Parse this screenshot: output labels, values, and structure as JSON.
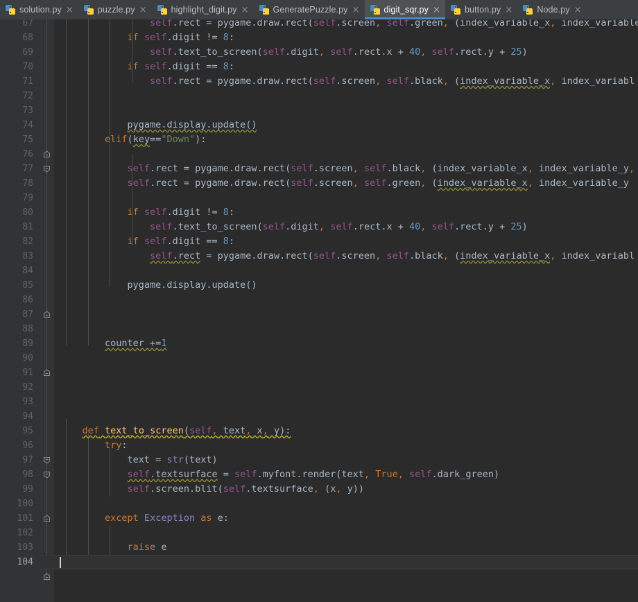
{
  "window": {
    "active_file": "digit_sqr.py",
    "accent_color": "#4a88c7",
    "editor_bg": "#2b2b2b",
    "gutter_bg": "#313335",
    "tabbar_bg": "#3c3f41"
  },
  "tabs": [
    {
      "label": "solution.py",
      "icon": "python-file-icon",
      "close_icon": "×",
      "active": false
    },
    {
      "label": "puzzle.py",
      "icon": "python-file-icon",
      "close_icon": "×",
      "active": false
    },
    {
      "label": "highlight_digit.py",
      "icon": "python-file-icon",
      "close_icon": "×",
      "active": false
    },
    {
      "label": "GeneratePuzzle.py",
      "icon": "python-file-icon",
      "close_icon": "×",
      "active": false
    },
    {
      "label": "digit_sqr.py",
      "icon": "python-file-icon",
      "close_icon": "×",
      "active": true
    },
    {
      "label": "button.py",
      "icon": "python-file-icon",
      "close_icon": "×",
      "active": false
    },
    {
      "label": "Node.py",
      "icon": "python-file-icon",
      "close_icon": "×",
      "active": false
    }
  ],
  "editor": {
    "current_line": 104,
    "first_visible_line": 67,
    "last_visible_line": 104,
    "caret_column": 1,
    "lines": [
      {
        "n": 67,
        "clipped_top": true,
        "text": "                self.rect = pygame.draw.rect(self.screen, self.green, (index_variable_x, index_variable_y"
      },
      {
        "n": 68,
        "text": "            if self.digit != 8:"
      },
      {
        "n": 69,
        "text": "                self.text_to_screen(self.digit, self.rect.x + 40, self.rect.y + 25)"
      },
      {
        "n": 70,
        "text": "            if self.digit == 8:"
      },
      {
        "n": 71,
        "text": "                self.rect = pygame.draw.rect(self.screen, self.black, (index_variable_x, index_variabl"
      },
      {
        "n": 72,
        "text": ""
      },
      {
        "n": 73,
        "text": ""
      },
      {
        "n": 74,
        "text": "            pygame.display.update()",
        "fold": "collapse-end"
      },
      {
        "n": 75,
        "text": "        elif(key==\"Down\"):",
        "fold": "collapse-start"
      },
      {
        "n": 76,
        "text": ""
      },
      {
        "n": 77,
        "text": "            self.rect = pygame.draw.rect(self.screen, self.black, (index_variable_x, index_variable_y,"
      },
      {
        "n": 78,
        "text": "            self.rect = pygame.draw.rect(self.screen, self.green, (index_variable_x, index_variable_y"
      },
      {
        "n": 79,
        "text": ""
      },
      {
        "n": 80,
        "text": "            if self.digit != 8:"
      },
      {
        "n": 81,
        "text": "                self.text_to_screen(self.digit, self.rect.x + 40, self.rect.y + 25)"
      },
      {
        "n": 82,
        "text": "            if self.digit == 8:"
      },
      {
        "n": 83,
        "text": "                self.rect = pygame.draw.rect(self.screen, self.black, (index_variable_x, index_variabl"
      },
      {
        "n": 84,
        "text": ""
      },
      {
        "n": 85,
        "text": "            pygame.display.update()",
        "fold": "collapse-end"
      },
      {
        "n": 86,
        "text": ""
      },
      {
        "n": 87,
        "text": ""
      },
      {
        "n": 88,
        "text": ""
      },
      {
        "n": 89,
        "text": "        counter +=1",
        "fold": "collapse-end"
      },
      {
        "n": 90,
        "text": ""
      },
      {
        "n": 91,
        "text": ""
      },
      {
        "n": 92,
        "text": ""
      },
      {
        "n": 93,
        "text": ""
      },
      {
        "n": 94,
        "text": ""
      },
      {
        "n": 95,
        "text": "    def text_to_screen(self, text, x, y):",
        "fold": "collapse-start"
      },
      {
        "n": 96,
        "text": "        try:",
        "fold": "collapse-start"
      },
      {
        "n": 97,
        "text": "            text = str(text)"
      },
      {
        "n": 98,
        "text": "            self.textsurface = self.myfont.render(text, True, self.dark_green)"
      },
      {
        "n": 99,
        "text": "            self.screen.blit(self.textsurface, (x, y))",
        "fold": "collapse-end"
      },
      {
        "n": 100,
        "text": ""
      },
      {
        "n": 101,
        "text": "        except Exception as e:"
      },
      {
        "n": 102,
        "text": ""
      },
      {
        "n": 103,
        "text": "            raise e",
        "fold": "collapse-end"
      },
      {
        "n": 104,
        "text": "",
        "current": true
      }
    ]
  },
  "syntax_colors": {
    "keyword": "#cc7832",
    "self": "#94558d",
    "number": "#6897bb",
    "string": "#6a8759",
    "function_name": "#ffc66d",
    "builtin": "#8888c6",
    "plain_text": "#a9b7c6",
    "line_number": "#606366",
    "warning_underline": "#8a8a36"
  }
}
